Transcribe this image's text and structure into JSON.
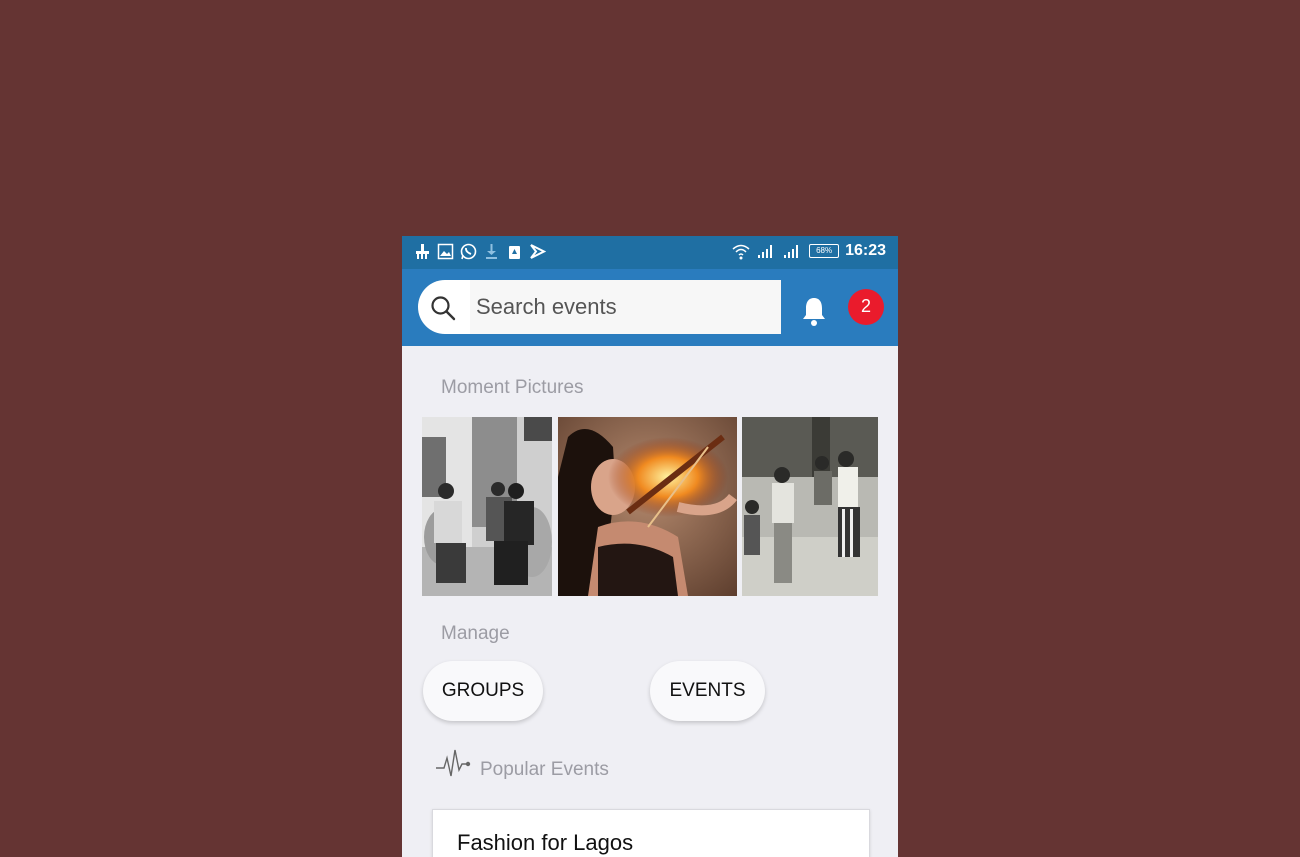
{
  "status_bar": {
    "time": "16:23",
    "battery": "68%",
    "left_icons": [
      "cleaner-icon",
      "gallery-icon",
      "whatsapp-icon",
      "download-icon",
      "lock-icon",
      "play-store-icon"
    ],
    "right_icons": [
      "wifi-icon",
      "signal-icon",
      "signal-icon",
      "battery-icon"
    ]
  },
  "header": {
    "search_placeholder": "Search events",
    "notification_count": "2"
  },
  "moment_pictures": {
    "label": "Moment Pictures"
  },
  "manage": {
    "label": "Manage",
    "groups_label": "GROUPS",
    "events_label": "EVENTS"
  },
  "popular_events": {
    "label": "Popular Events",
    "items": [
      {
        "title": "Fashion for Lagos"
      }
    ]
  },
  "colors": {
    "background": "#653433",
    "status_bar": "#1f6fa3",
    "app_bar": "#2a7cbe",
    "badge": "#ea1b2c",
    "content_bg": "#efeff4"
  }
}
